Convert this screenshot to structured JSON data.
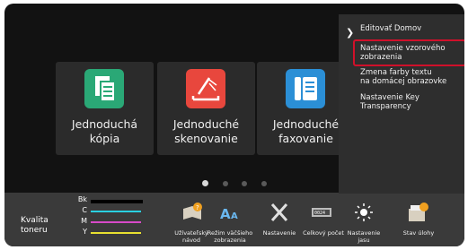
{
  "tiles": [
    {
      "label": "Jednoduchá\nkópia",
      "color": "#2aa876"
    },
    {
      "label": "Jednoduché\nskenovanie",
      "color": "#e8473d"
    },
    {
      "label": "Jednoduché\nfaxovanie",
      "color": "#2b8fd6"
    }
  ],
  "pager": {
    "pages": 4,
    "current": 1
  },
  "toner": {
    "label": "Kvalita\ntoneru",
    "channels": [
      {
        "code": "Bk",
        "color": "#000000",
        "level": 1.0
      },
      {
        "code": "C",
        "color": "#2ad0e0",
        "level": 1.0
      },
      {
        "code": "M",
        "color": "#d84ac8",
        "level": 1.0
      },
      {
        "code": "Y",
        "color": "#e8e030",
        "level": 1.0
      }
    ]
  },
  "bottom_items": [
    {
      "label": "Užívateľský\nnávod",
      "icon": "user-guide-icon"
    },
    {
      "label": "Režim väčšieho\nzobrazenia",
      "icon": "text-size-icon"
    },
    {
      "label": "Nastavenie",
      "icon": "settings-tools-icon"
    },
    {
      "label": "Celkový počet",
      "icon": "counter-icon"
    },
    {
      "label": "Nastavenie\njasu",
      "icon": "brightness-icon"
    },
    {
      "label": "Stav úlohy",
      "icon": "job-status-icon"
    }
  ],
  "menu": {
    "items": [
      {
        "label": "Editovať Domov"
      },
      {
        "label": "Nastavenie vzorového\nzobrazenia",
        "selected": true
      },
      {
        "label": "Zmena farby textu\nna domácej obrazovke"
      },
      {
        "label": "Nastavenie Key\nTransparency"
      }
    ]
  }
}
